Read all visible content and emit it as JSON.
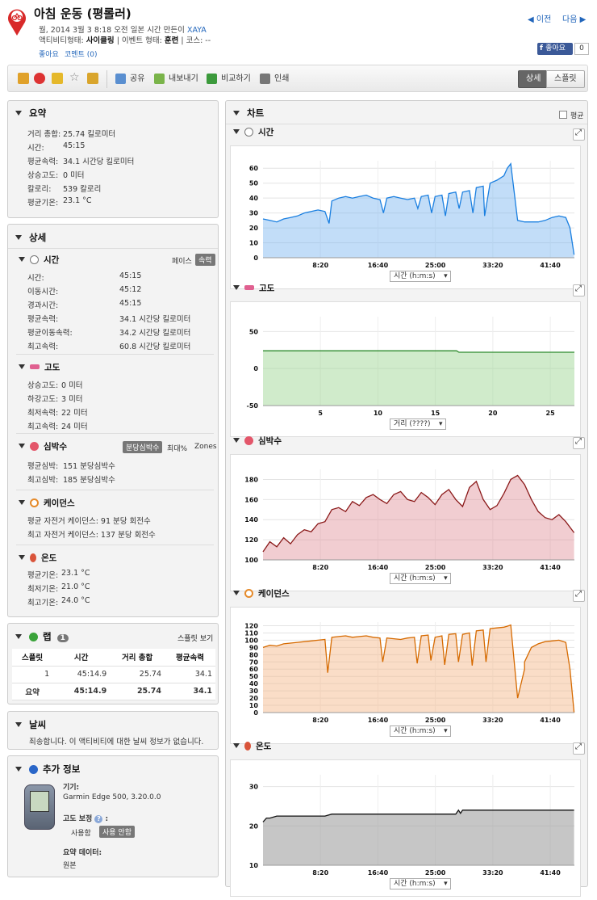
{
  "header": {
    "title": "아침 운동 (평롤러)",
    "meta": "월, 2014 3월 3 8:18 오전 일본 시간 만든이",
    "author": "XAYA",
    "activity_label": "액티비티형태:",
    "activity_value": "사이클링",
    "event_label": "| 이벤트 형태:",
    "event_value": "훈련",
    "course_label": "| 코스: --",
    "like": "좋아요",
    "comments": "코멘트 (0)",
    "prev": "이전",
    "next": "다음",
    "fb_like": "좋아요",
    "fb_count": "0"
  },
  "toolbar": {
    "share": "공유",
    "export": "내보내기",
    "compare": "비교하기",
    "print": "인쇄",
    "detail": "상세",
    "splits": "스플릿"
  },
  "summary": {
    "title": "요약",
    "rows": [
      [
        "거리 총합:",
        "25.74 킬로미터"
      ],
      [
        "시간:",
        "45:15"
      ],
      [
        "평균속력:",
        "34.1 시간당 킬로미터"
      ],
      [
        "상승고도:",
        "0 미터"
      ],
      [
        "칼로리:",
        "539 칼로리"
      ],
      [
        "평균기온:",
        "23.1 °C"
      ]
    ]
  },
  "detail": {
    "title": "상세",
    "time": {
      "title": "시간",
      "pace": "페이스",
      "speed": "속력",
      "rows": [
        [
          "시간:",
          "45:15"
        ],
        [
          "이동시간:",
          "45:12"
        ],
        [
          "경과시간:",
          "45:15"
        ],
        [
          "평균속력:",
          "34.1 시간당 킬로미터"
        ],
        [
          "평균이동속력:",
          "34.2 시간당 킬로미터"
        ],
        [
          "최고속력:",
          "60.8 시간당 킬로미터"
        ]
      ]
    },
    "elev": {
      "title": "고도",
      "rows": [
        [
          "상승고도:",
          "0 미터"
        ],
        [
          "하강고도:",
          "3 미터"
        ],
        [
          "최저속력:",
          "22 미터"
        ],
        [
          "최고속력:",
          "24 미터"
        ]
      ]
    },
    "hr": {
      "title": "심박수",
      "bpm": "분당심박수",
      "max": "최대%",
      "zones": "Zones",
      "rows": [
        [
          "평균심박:",
          "151 분당심박수"
        ],
        [
          "최고심박:",
          "185 분당심박수"
        ]
      ]
    },
    "cad": {
      "title": "케이던스",
      "rows": [
        "평균 자전거 케이던스: 91 분당 회전수",
        "최고 자전거 케이던스: 137 분당 회전수"
      ]
    },
    "temp": {
      "title": "온도",
      "rows": [
        [
          "평균기온:",
          "23.1 °C"
        ],
        [
          "최저기온:",
          "21.0 °C"
        ],
        [
          "최고기온:",
          "24.0 °C"
        ]
      ]
    }
  },
  "laps": {
    "title": "랩",
    "count": "1",
    "view": "스플릿 보기",
    "headers": [
      "스플릿",
      "시간",
      "거리 총합",
      "평균속력"
    ],
    "rows": [
      [
        "1",
        "45:14.9",
        "25.74",
        "34.1"
      ]
    ],
    "total": [
      "요약",
      "45:14.9",
      "25.74",
      "34.1"
    ]
  },
  "weather": {
    "title": "날씨",
    "text": "죄송합니다. 이 액티비티에 대한 날씨 정보가 없습니다."
  },
  "extra": {
    "title": "추가 정보",
    "device_label": "기기:",
    "device": "Garmin Edge 500, 3.20.0.0",
    "elev_corr": "고도 보정",
    "use": "사용함",
    "not_use": "사용 안함",
    "summary_data": "요약 데이터:",
    "original": "원본"
  },
  "charts_panel": {
    "title": "차트",
    "avg": "평균"
  },
  "colors": {
    "speed": "#1a7fe0",
    "elev": "#2e8b2e",
    "hr": "#8b1a1a",
    "cad": "#d66a00",
    "temp": "#111111"
  },
  "chart_data": [
    {
      "type": "area",
      "title": "시간",
      "axis_select": "시간 (h:m:s)",
      "xticks": [
        "8:20",
        "16:40",
        "25:00",
        "33:20",
        "41:40"
      ],
      "xlim": [
        0,
        45.25
      ],
      "ylim": [
        0,
        65
      ],
      "yticks": [
        0,
        10,
        20,
        30,
        40,
        50,
        60
      ],
      "x": [
        0,
        1,
        2,
        3,
        4,
        5,
        6,
        7,
        8,
        9,
        9.6,
        10,
        11,
        12,
        13,
        14,
        15,
        16,
        17,
        17.5,
        18,
        19,
        20,
        21,
        22,
        22.5,
        23,
        24,
        24.5,
        25,
        26,
        26.5,
        27,
        28,
        28.5,
        29,
        30,
        30.5,
        31,
        32,
        32.2,
        33,
        34,
        35,
        35.5,
        36,
        37,
        38,
        38,
        39,
        40,
        41,
        42,
        43,
        44,
        44.6,
        45.2
      ],
      "y": [
        26,
        25,
        24,
        26,
        27,
        28,
        30,
        31,
        32,
        31,
        23,
        38,
        40,
        41,
        40,
        41,
        42,
        40,
        39,
        30,
        40,
        41,
        40,
        39,
        40,
        33,
        41,
        42,
        30,
        41,
        42,
        28,
        43,
        44,
        33,
        44,
        45,
        30,
        47,
        48,
        28,
        50,
        52,
        55,
        60,
        63,
        25,
        24,
        24,
        24,
        24,
        25,
        27,
        28,
        27,
        20,
        2
      ]
    },
    {
      "type": "area",
      "title": "고도",
      "axis_select": "거리 (????)",
      "xticks": [
        "5",
        "10",
        "15",
        "20",
        "25"
      ],
      "xlim": [
        0,
        25.74
      ],
      "ylim": [
        -50,
        70
      ],
      "yticks": [
        -50,
        0,
        50
      ],
      "x": [
        0,
        2,
        4,
        6,
        8,
        10,
        12,
        14,
        16,
        16.2,
        18,
        20,
        22,
        24,
        25.74
      ],
      "y": [
        24,
        24,
        24,
        24,
        24,
        24,
        24,
        24,
        24,
        22,
        22,
        22,
        22,
        22,
        22
      ]
    },
    {
      "type": "area",
      "title": "심박수",
      "axis_select": "시간 (h:m:s)",
      "xticks": [
        "8:20",
        "16:40",
        "25:00",
        "33:20",
        "41:40"
      ],
      "xlim": [
        0,
        45.25
      ],
      "ylim": [
        100,
        190
      ],
      "yticks": [
        100,
        120,
        140,
        160,
        180
      ],
      "x": [
        0,
        1,
        2,
        3,
        4,
        5,
        6,
        7,
        8,
        9,
        10,
        11,
        12,
        13,
        14,
        15,
        16,
        17,
        18,
        19,
        20,
        21,
        22,
        23,
        24,
        25,
        26,
        27,
        28,
        29,
        30,
        31,
        32,
        33,
        34,
        35,
        36,
        37,
        38,
        39,
        40,
        41,
        42,
        43,
        44,
        45.2
      ],
      "y": [
        108,
        118,
        113,
        122,
        116,
        125,
        130,
        128,
        136,
        138,
        150,
        152,
        148,
        158,
        154,
        162,
        165,
        160,
        156,
        165,
        168,
        160,
        158,
        167,
        162,
        155,
        165,
        170,
        160,
        153,
        172,
        178,
        160,
        150,
        154,
        166,
        180,
        184,
        175,
        160,
        148,
        142,
        140,
        145,
        138,
        127
      ]
    },
    {
      "type": "area",
      "title": "케이던스",
      "axis_select": "시간 (h:m:s)",
      "xticks": [
        "8:20",
        "16:40",
        "25:00",
        "33:20",
        "41:40"
      ],
      "xlim": [
        0,
        45.25
      ],
      "ylim": [
        0,
        125
      ],
      "yticks": [
        0,
        10,
        20,
        30,
        40,
        50,
        60,
        70,
        80,
        90,
        100,
        110,
        120
      ],
      "x": [
        0,
        1,
        2,
        3,
        4,
        5,
        6,
        7,
        8,
        9,
        9.4,
        10,
        11,
        12,
        13,
        14,
        15,
        16,
        17,
        17.4,
        18,
        19,
        20,
        21,
        22,
        22.4,
        23,
        24,
        24.4,
        25,
        26,
        26.4,
        27,
        28,
        28.4,
        29,
        30,
        30.4,
        31,
        32,
        32.4,
        33,
        34,
        35,
        35.4,
        36,
        37,
        38,
        38,
        39,
        40,
        41,
        42,
        43,
        44,
        44.6,
        45.2
      ],
      "y": [
        90,
        93,
        92,
        95,
        96,
        97,
        98,
        99,
        100,
        101,
        55,
        104,
        105,
        106,
        104,
        105,
        106,
        104,
        103,
        70,
        103,
        102,
        101,
        103,
        104,
        68,
        106,
        107,
        72,
        104,
        106,
        66,
        108,
        109,
        70,
        108,
        110,
        65,
        113,
        114,
        70,
        116,
        117,
        118,
        119,
        121,
        20,
        60,
        70,
        90,
        95,
        98,
        99,
        100,
        97,
        60,
        0
      ]
    },
    {
      "type": "area",
      "title": "온도",
      "axis_select": "시간 (h:m:s)",
      "xticks": [
        "8:20",
        "16:40",
        "25:00",
        "33:20",
        "41:40"
      ],
      "xlim": [
        0,
        45.25
      ],
      "ylim": [
        10,
        33
      ],
      "yticks": [
        10,
        20,
        30
      ],
      "x": [
        0,
        0.5,
        1,
        2,
        5,
        9,
        10,
        12,
        15,
        20,
        25,
        28,
        28.4,
        28.7,
        29,
        30,
        33,
        36,
        40,
        45.2
      ],
      "y": [
        21,
        22,
        22,
        22.5,
        22.5,
        22.5,
        23,
        23,
        23,
        23,
        23,
        23,
        24,
        23.2,
        24,
        24,
        24,
        24,
        24,
        24
      ]
    }
  ]
}
